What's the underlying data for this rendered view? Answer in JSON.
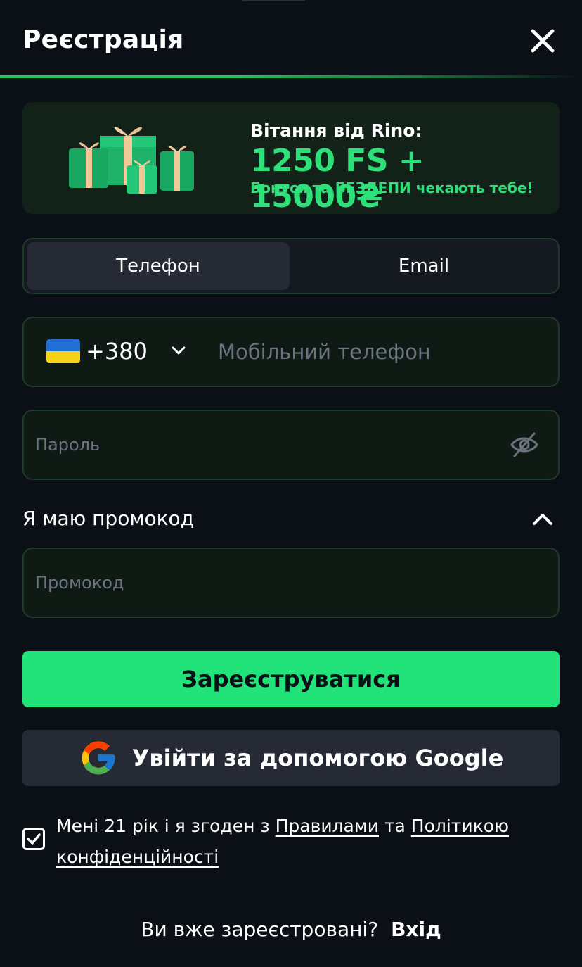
{
  "header": {
    "title": "Реєстрація"
  },
  "banner": {
    "greeting": "Вітання від Rino:",
    "offer": "1250 FS + 15000₴",
    "subtitle": "Бонуси та БЕЗДЕПИ чекають тебе!"
  },
  "tabs": [
    {
      "label": "Телефон",
      "active": true
    },
    {
      "label": "Email",
      "active": false
    }
  ],
  "phone": {
    "country_code": "+380",
    "placeholder": "Мобільний телефон",
    "value": ""
  },
  "password": {
    "placeholder": "Пароль",
    "value": ""
  },
  "promo": {
    "toggle_label": "Я маю промокод",
    "placeholder": "Промокод",
    "value": ""
  },
  "actions": {
    "register_label": "Зареєструватися",
    "google_label": "Увійти за допомогою Google"
  },
  "consent": {
    "checked": true,
    "text_before": "Мені 21 рік і я згоден з ",
    "rules_link": "Правилами",
    "text_middle": " та ",
    "privacy_link": "Політикою конфіденційності"
  },
  "footer": {
    "question": "Ви вже зареєстровані?",
    "login_link": "Вхід"
  },
  "colors": {
    "accent": "#22e27a",
    "background": "#0b0f16",
    "field_border": "#1f3a2a"
  }
}
